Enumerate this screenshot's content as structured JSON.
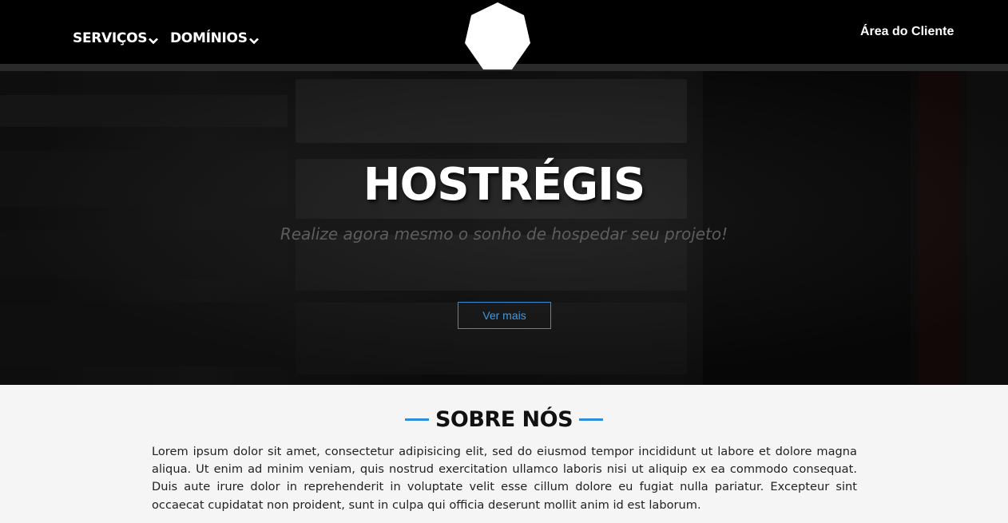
{
  "header": {
    "nav": [
      {
        "label": "SERVIÇOS"
      },
      {
        "label": "DOMÍNIOS"
      }
    ],
    "client_area_label": "Área do Cliente",
    "logo_icon": "heptagon-logo"
  },
  "hero": {
    "title": "HOSTRÉGIS",
    "subtitle": "Realize agora mesmo o sonho de hospedar seu projeto!",
    "button_label": "Ver mais",
    "accent_color": "#2f8fd8"
  },
  "about": {
    "title": "SOBRE NÓS",
    "text": "Lorem ipsum dolor sit amet, consectetur adipisicing elit, sed do eiusmod tempor incididunt ut labore et dolore magna aliqua. Ut enim ad minim veniam, quis nostrud exercitation ullamco laboris nisi ut aliquip ex ea commodo consequat. Duis aute irure dolor in reprehenderit in voluptate velit esse cillum dolore eu fugiat nulla pariatur. Excepteur sint occaecat cupidatat non proident, sunt in culpa qui officia deserunt mollit anim id est laborum."
  }
}
